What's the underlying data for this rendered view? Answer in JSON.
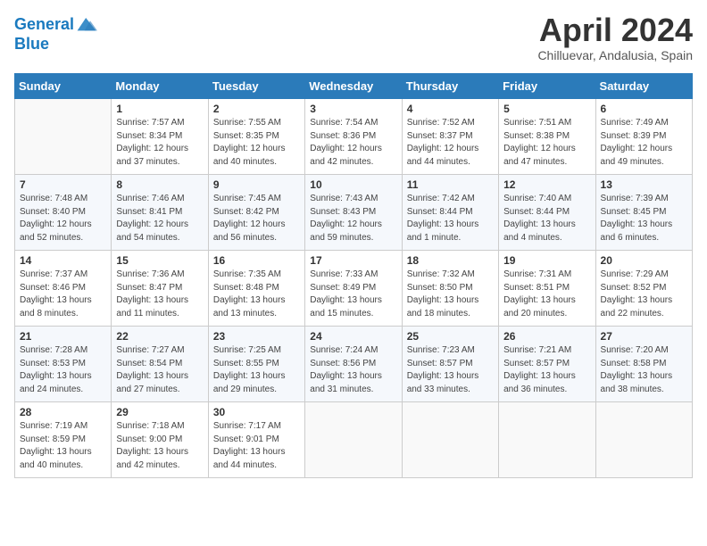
{
  "header": {
    "logo_line1": "General",
    "logo_line2": "Blue",
    "month_title": "April 2024",
    "subtitle": "Chilluevar, Andalusia, Spain"
  },
  "weekdays": [
    "Sunday",
    "Monday",
    "Tuesday",
    "Wednesday",
    "Thursday",
    "Friday",
    "Saturday"
  ],
  "weeks": [
    [
      {
        "day": "",
        "detail": ""
      },
      {
        "day": "1",
        "detail": "Sunrise: 7:57 AM\nSunset: 8:34 PM\nDaylight: 12 hours\nand 37 minutes."
      },
      {
        "day": "2",
        "detail": "Sunrise: 7:55 AM\nSunset: 8:35 PM\nDaylight: 12 hours\nand 40 minutes."
      },
      {
        "day": "3",
        "detail": "Sunrise: 7:54 AM\nSunset: 8:36 PM\nDaylight: 12 hours\nand 42 minutes."
      },
      {
        "day": "4",
        "detail": "Sunrise: 7:52 AM\nSunset: 8:37 PM\nDaylight: 12 hours\nand 44 minutes."
      },
      {
        "day": "5",
        "detail": "Sunrise: 7:51 AM\nSunset: 8:38 PM\nDaylight: 12 hours\nand 47 minutes."
      },
      {
        "day": "6",
        "detail": "Sunrise: 7:49 AM\nSunset: 8:39 PM\nDaylight: 12 hours\nand 49 minutes."
      }
    ],
    [
      {
        "day": "7",
        "detail": "Sunrise: 7:48 AM\nSunset: 8:40 PM\nDaylight: 12 hours\nand 52 minutes."
      },
      {
        "day": "8",
        "detail": "Sunrise: 7:46 AM\nSunset: 8:41 PM\nDaylight: 12 hours\nand 54 minutes."
      },
      {
        "day": "9",
        "detail": "Sunrise: 7:45 AM\nSunset: 8:42 PM\nDaylight: 12 hours\nand 56 minutes."
      },
      {
        "day": "10",
        "detail": "Sunrise: 7:43 AM\nSunset: 8:43 PM\nDaylight: 12 hours\nand 59 minutes."
      },
      {
        "day": "11",
        "detail": "Sunrise: 7:42 AM\nSunset: 8:44 PM\nDaylight: 13 hours\nand 1 minute."
      },
      {
        "day": "12",
        "detail": "Sunrise: 7:40 AM\nSunset: 8:44 PM\nDaylight: 13 hours\nand 4 minutes."
      },
      {
        "day": "13",
        "detail": "Sunrise: 7:39 AM\nSunset: 8:45 PM\nDaylight: 13 hours\nand 6 minutes."
      }
    ],
    [
      {
        "day": "14",
        "detail": "Sunrise: 7:37 AM\nSunset: 8:46 PM\nDaylight: 13 hours\nand 8 minutes."
      },
      {
        "day": "15",
        "detail": "Sunrise: 7:36 AM\nSunset: 8:47 PM\nDaylight: 13 hours\nand 11 minutes."
      },
      {
        "day": "16",
        "detail": "Sunrise: 7:35 AM\nSunset: 8:48 PM\nDaylight: 13 hours\nand 13 minutes."
      },
      {
        "day": "17",
        "detail": "Sunrise: 7:33 AM\nSunset: 8:49 PM\nDaylight: 13 hours\nand 15 minutes."
      },
      {
        "day": "18",
        "detail": "Sunrise: 7:32 AM\nSunset: 8:50 PM\nDaylight: 13 hours\nand 18 minutes."
      },
      {
        "day": "19",
        "detail": "Sunrise: 7:31 AM\nSunset: 8:51 PM\nDaylight: 13 hours\nand 20 minutes."
      },
      {
        "day": "20",
        "detail": "Sunrise: 7:29 AM\nSunset: 8:52 PM\nDaylight: 13 hours\nand 22 minutes."
      }
    ],
    [
      {
        "day": "21",
        "detail": "Sunrise: 7:28 AM\nSunset: 8:53 PM\nDaylight: 13 hours\nand 24 minutes."
      },
      {
        "day": "22",
        "detail": "Sunrise: 7:27 AM\nSunset: 8:54 PM\nDaylight: 13 hours\nand 27 minutes."
      },
      {
        "day": "23",
        "detail": "Sunrise: 7:25 AM\nSunset: 8:55 PM\nDaylight: 13 hours\nand 29 minutes."
      },
      {
        "day": "24",
        "detail": "Sunrise: 7:24 AM\nSunset: 8:56 PM\nDaylight: 13 hours\nand 31 minutes."
      },
      {
        "day": "25",
        "detail": "Sunrise: 7:23 AM\nSunset: 8:57 PM\nDaylight: 13 hours\nand 33 minutes."
      },
      {
        "day": "26",
        "detail": "Sunrise: 7:21 AM\nSunset: 8:57 PM\nDaylight: 13 hours\nand 36 minutes."
      },
      {
        "day": "27",
        "detail": "Sunrise: 7:20 AM\nSunset: 8:58 PM\nDaylight: 13 hours\nand 38 minutes."
      }
    ],
    [
      {
        "day": "28",
        "detail": "Sunrise: 7:19 AM\nSunset: 8:59 PM\nDaylight: 13 hours\nand 40 minutes."
      },
      {
        "day": "29",
        "detail": "Sunrise: 7:18 AM\nSunset: 9:00 PM\nDaylight: 13 hours\nand 42 minutes."
      },
      {
        "day": "30",
        "detail": "Sunrise: 7:17 AM\nSunset: 9:01 PM\nDaylight: 13 hours\nand 44 minutes."
      },
      {
        "day": "",
        "detail": ""
      },
      {
        "day": "",
        "detail": ""
      },
      {
        "day": "",
        "detail": ""
      },
      {
        "day": "",
        "detail": ""
      }
    ]
  ]
}
